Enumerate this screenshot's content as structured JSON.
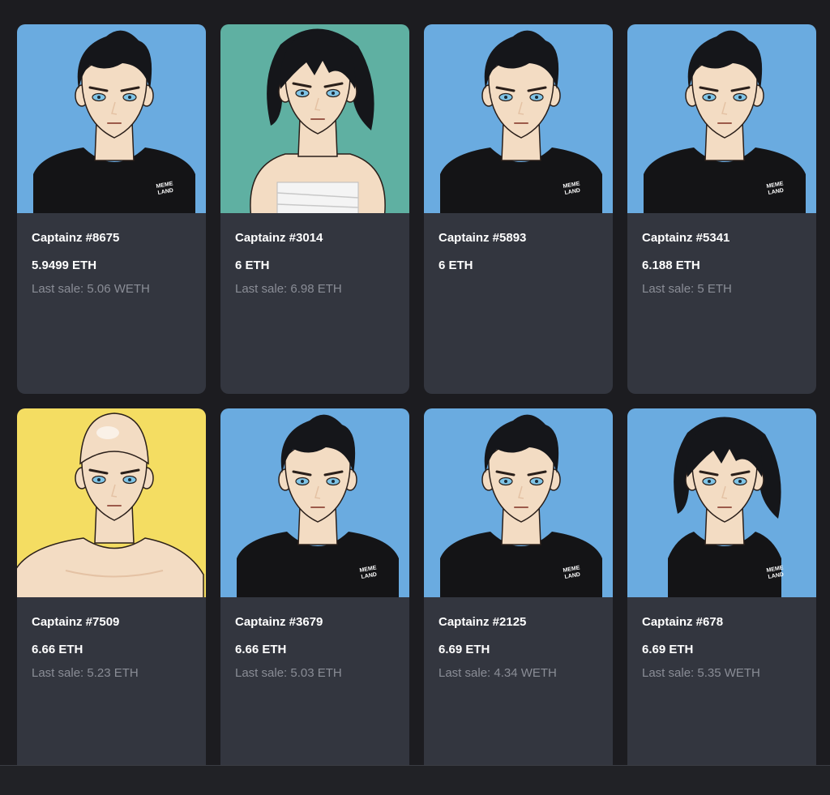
{
  "cards": [
    {
      "name": "Captainz #8675",
      "price": "5.9499 ETH",
      "last_sale": "Last sale: 5.06 WETH",
      "bg": "#6aabe0",
      "avatar": "male-shirt"
    },
    {
      "name": "Captainz #3014",
      "price": "6 ETH",
      "last_sale": "Last sale: 6.98 ETH",
      "bg": "#5fb0a2",
      "avatar": "female-wrap"
    },
    {
      "name": "Captainz #5893",
      "price": "6 ETH",
      "last_sale": "",
      "bg": "#6aabe0",
      "avatar": "male-shirt"
    },
    {
      "name": "Captainz #5341",
      "price": "6.188 ETH",
      "last_sale": "Last sale: 5 ETH",
      "bg": "#6aabe0",
      "avatar": "male-shirt"
    },
    {
      "name": "Captainz #7509",
      "price": "6.66 ETH",
      "last_sale": "Last sale: 5.23 ETH",
      "bg": "#f4dd62",
      "avatar": "bald-shirtless"
    },
    {
      "name": "Captainz #3679",
      "price": "6.66 ETH",
      "last_sale": "Last sale: 5.03 ETH",
      "bg": "#6aabe0",
      "avatar": "male-shirt"
    },
    {
      "name": "Captainz #2125",
      "price": "6.69 ETH",
      "last_sale": "Last sale: 4.34 WETH",
      "bg": "#6aabe0",
      "avatar": "male-shirt"
    },
    {
      "name": "Captainz #678",
      "price": "6.69 ETH",
      "last_sale": "Last sale: 5.35 WETH",
      "bg": "#6aabe0",
      "avatar": "female-shirt"
    }
  ],
  "shirt_logo": "MEME LAND"
}
